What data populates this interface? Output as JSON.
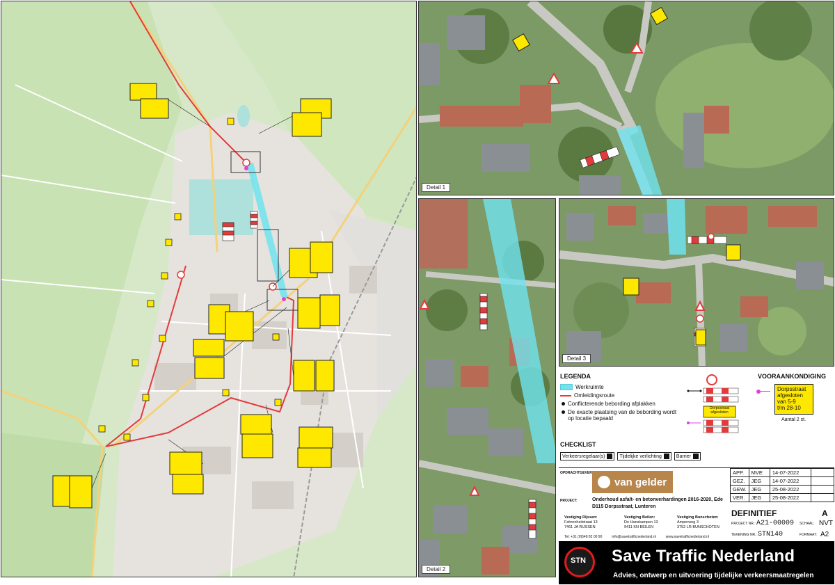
{
  "details": {
    "detail1": "Detail 1",
    "detail2": "Detail 2",
    "detail3": "Detail 3"
  },
  "legend": {
    "title": "LEGENDA",
    "items": [
      {
        "label": "Werkruimte",
        "kind": "cyan"
      },
      {
        "label": "Omleidingsroute",
        "kind": "red"
      },
      {
        "label": "Conflicterende bebording afplakken",
        "kind": "dot"
      },
      {
        "label": "De exacte plaatsing van de bebording wordt op locatie bepaald",
        "kind": "dot"
      }
    ],
    "sign_text": "Dorpsstraat afgesloten"
  },
  "vooraankondiging": {
    "title": "VOORAANKONDIGING",
    "line1": "Dorpsstraat",
    "line2": "afgesloten",
    "line3": "van 5-9",
    "line4": "t/m 28-10",
    "count": "Aantal 2 st."
  },
  "checklist": {
    "title": "CHECKLIST",
    "items": [
      "Verkeersregelaar(s)",
      "Tijdelijke verlichting",
      "Barrier"
    ]
  },
  "titleblock": {
    "opdrachtgever_label": "OPDRACHTGEVER:",
    "client": "van gelder",
    "project_label": "PROJECT:",
    "project_line1": "Onderhoud asfalt- en betonverhardingen 2016-2020, Ede",
    "project_line2": "D115 Dorpsstraat, Lunteren",
    "status": "DEFINITIEF",
    "revision": "A",
    "project_nr_label": "PROJECT NR.:",
    "project_nr": "A21-00009",
    "schaal_label": "SCHAAL:",
    "schaal": "NVT",
    "tekening_label": "TEKENING NR.:",
    "tekening": "STN140",
    "formaat_label": "FORMAAT:",
    "formaat": "A2",
    "revisions": [
      {
        "label": "APP.",
        "name": "MVE",
        "date": "14-07-2022"
      },
      {
        "label": "GEZ.",
        "name": "JEG",
        "date": "14-07-2022"
      },
      {
        "label": "GEW.",
        "name": "JEG",
        "date": "25-08-2022"
      },
      {
        "label": "VER.",
        "name": "JEG",
        "date": "25-08-2022"
      }
    ],
    "vestigingen": [
      {
        "name": "Vestiging Rijssen:",
        "addr1": "Fahrenheitstraat 13",
        "addr2": "7461 JA RIJSSEN"
      },
      {
        "name": "Vestiging Beilen:",
        "addr1": "De Hanskampen 13",
        "addr2": "9411 KN BEILEN"
      },
      {
        "name": "Vestiging Bunschoten:",
        "addr1": "Amperweg 3",
        "addr2": "3752 LR BUNSCHOTEN"
      }
    ],
    "phone": "Tel: +31 (0)548 82 00 90",
    "email": "info@savetrafficnederland.nl",
    "web": "www.savetrafficnederland.nl"
  },
  "brand": {
    "logo_text": "STN",
    "name": "Save Traffic Nederland",
    "tagline": "Advies, ontwerp en uitvoering tijdelijke verkeersmaatregelen"
  },
  "colors": {
    "workzone": "#6fe3ef",
    "detour": "#e23b3b",
    "sign": "#ffe800",
    "marker": "#e040e0"
  }
}
